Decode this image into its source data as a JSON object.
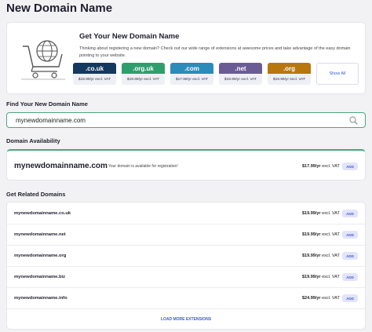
{
  "page": {
    "title": "New Domain Name"
  },
  "promo": {
    "heading": "Get Your New Domain Name",
    "description": "Thinking about registering a new domain? Check out our wide range of extensions at awesome prices and take advantage of the easy domain pointing to your website.",
    "tlds": [
      {
        "name": ".co.uk",
        "price": "$19.99/yr excl. VAT",
        "color": "#13395e"
      },
      {
        "name": ".org.uk",
        "price": "$19.99/yr excl. VAT",
        "color": "#2f9e6d"
      },
      {
        "name": ".com",
        "price": "$17.99/yr excl. VAT",
        "color": "#2b8cba"
      },
      {
        "name": ".net",
        "price": "$19.99/yr excl. VAT",
        "color": "#6b5b95"
      },
      {
        "name": ".org",
        "price": "$19.99/yr excl. VAT",
        "color": "#b8760f"
      }
    ],
    "show_all": "Show All"
  },
  "search": {
    "label": "Find Your New Domain Name",
    "value": "mynewdomainname.com"
  },
  "availability": {
    "label": "Domain Availability",
    "domain": "mynewdomainname.com",
    "message": "- Your domain is available for registration!",
    "price": "$17.99/yr",
    "price_suffix": "excl. VAT",
    "add_label": "ADD"
  },
  "related": {
    "label": "Get Related Domains",
    "rows": [
      {
        "domain": "mynewdomainname.co.uk",
        "price": "$19.99/yr",
        "suffix": "excl. VAT",
        "add": "ADD"
      },
      {
        "domain": "mynewdomainname.net",
        "price": "$19.99/yr",
        "suffix": "excl. VAT",
        "add": "ADD"
      },
      {
        "domain": "mynewdomainname.org",
        "price": "$19.99/yr",
        "suffix": "excl. VAT",
        "add": "ADD"
      },
      {
        "domain": "mynewdomainname.biz",
        "price": "$19.99/yr",
        "suffix": "excl. VAT",
        "add": "ADD"
      },
      {
        "domain": "mynewdomainname.info",
        "price": "$24.99/yr",
        "suffix": "excl. VAT",
        "add": "ADD"
      }
    ],
    "load_more": "LOAD MORE EXTENSIONS"
  },
  "colors": {
    "accent": "#3b5bdb",
    "success": "#4aa77c"
  }
}
